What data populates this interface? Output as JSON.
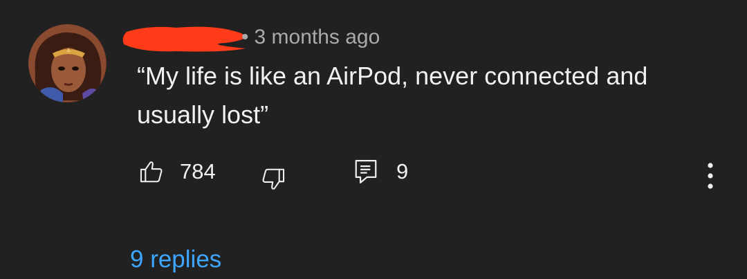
{
  "comment": {
    "avatar_alt": "avatar",
    "author_redacted": true,
    "timestamp": "3 months ago",
    "meta_separator": "•",
    "text": "“My life is like an AirPod, never connected and usually lost”",
    "like_count": "784",
    "reply_count": "9",
    "replies_label": "9 replies"
  },
  "icons": {
    "like": "thumbs-up-icon",
    "dislike": "thumbs-down-icon",
    "reply": "comment-icon",
    "more": "more-vert-icon"
  },
  "colors": {
    "background": "#212121",
    "text": "#f1f1f1",
    "secondary_text": "#aaaaaa",
    "link": "#3ea6ff",
    "redaction": "#ff3b1a"
  }
}
